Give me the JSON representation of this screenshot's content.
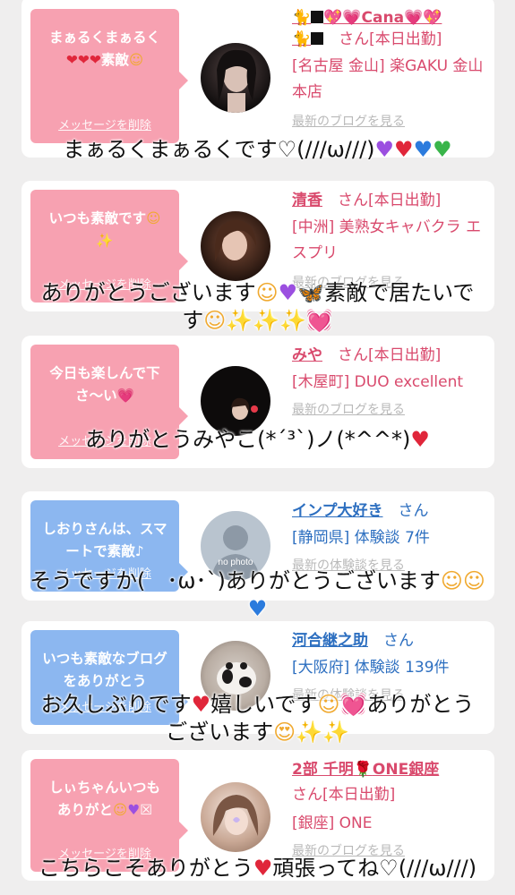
{
  "cards": [
    {
      "bubble_text": "まぁるくまぁるく❤️❤️❤️素敵🥰",
      "delete_label": "メッセージを削除",
      "name": "🐈⬛💖💗Cana💗💖",
      "name_line2": "🐈⬛",
      "san": "さん[本日出勤]",
      "detail": "[名古屋 金山] 楽GAKU 金山本店",
      "blog_link": "最新のブログを見る",
      "reply": "まぁるくまぁるくです♡(///ω///)💜❤️💙💚"
    },
    {
      "bubble_text": "いつも素敵です🥰✨",
      "delete_label": "メッセージを削除",
      "name": "清香",
      "san": "さん[本日出勤]",
      "detail": "[中洲] 美熟女キャバクラ エスプリ",
      "blog_link": "最新のブログを見る",
      "reply": "ありがとうございます☺️💜🦋素敵で居たいです😌✨✨✨💓"
    },
    {
      "bubble_text": "今日も楽しんで下さ〜い💗",
      "delete_label": "メッセージを削除",
      "name": "みや",
      "san": "さん[本日出勤]",
      "detail": "[木屋町] DUO excellent",
      "blog_link": "最新のブログを見る",
      "reply": "ありがとうみやこ(*´³`)ノ(*^^*)❤️"
    },
    {
      "bubble_text": "しおりさんは、スマートで素敵♪",
      "delete_label": "メッセージを削除",
      "name": "インプ大好き",
      "san": "さん",
      "detail": "[静岡県] 体験談 7件",
      "blog_link": "最新の体験談を見る",
      "avatar_text": "no photo",
      "reply": "そうですか(　･ω･`)ありがとうございます😌😌💙"
    },
    {
      "bubble_text": "いつも素敵なブログをありがとう",
      "delete_label": "メッセージを削除",
      "name": "河合継之助",
      "san": "さん",
      "detail": "[大阪府] 体験談 139件",
      "blog_link": "最新の体験談を見る",
      "reply": "お久しぶりです❤️嬉しいです😌💓ありがとうございます😍✨✨"
    },
    {
      "bubble_text": "しぃちゃんいつもありがと🥺💜☒",
      "delete_label": "メッセージを削除",
      "name": "2部 千明🌹ONE銀座",
      "san": "さん[本日出勤]",
      "detail": "[銀座] ONE",
      "blog_link": "最新のブログを見る",
      "reply": "こちらこそありがとう❤️頑張ってね♡(///ω///)"
    }
  ],
  "colors": {
    "pink_bubble": "#f7a1b1",
    "blue_bubble": "#8cb7f0",
    "pink_text": "#d94a6d",
    "blue_text": "#2d6fc0"
  }
}
